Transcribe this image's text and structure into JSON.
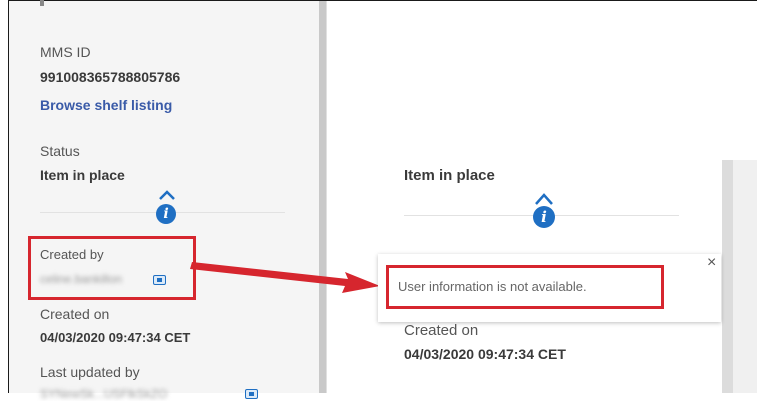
{
  "left_panel": {
    "mms_id_label": "MMS ID",
    "mms_id_value": "991008365788805786",
    "browse_shelf_link": "Browse shelf listing",
    "status_label": "Status",
    "status_value": "Item in place",
    "created_by_label": "Created by",
    "created_by_value": "celine.bankillon",
    "created_on_label": "Created on",
    "created_on_value": "04/03/2020 09:47:34 CET",
    "last_updated_by_label": "Last updated by",
    "last_updated_by_value": "SYNewSk...USFlkSkZO"
  },
  "zoom_panel": {
    "status_value": "Item in place",
    "tooltip_message": "User information is not available.",
    "tooltip_close": "×",
    "created_on_label": "Created on",
    "created_on_value": "04/03/2020 09:47:34 CET"
  },
  "icons": {
    "info": "i",
    "chevron": "chevron-up-icon"
  },
  "colors": {
    "highlight": "#d6262e",
    "info_blue": "#1f6fc3",
    "link": "#3a5ba8"
  }
}
